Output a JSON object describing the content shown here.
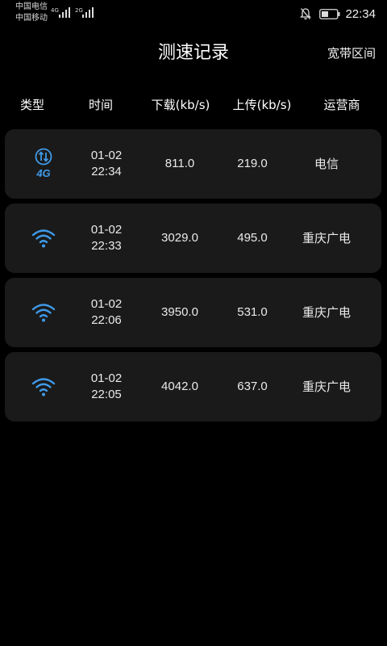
{
  "status_bar": {
    "carrier_1": "中国电信",
    "carrier_2": "中国移动",
    "net_1": "4G",
    "net_2": "2G",
    "time": "22:34"
  },
  "header": {
    "title": "测速记录",
    "bandwidth_label": "宽带区间"
  },
  "columns": [
    "类型",
    "时间",
    "下载(kb/s)",
    "上传(kb/s)",
    "运营商"
  ],
  "records": [
    {
      "type_icon": "4g-icon",
      "date": "01-02",
      "time": "22:34",
      "download": "811.0",
      "upload": "219.0",
      "carrier": "电信"
    },
    {
      "type_icon": "wifi-icon",
      "date": "01-02",
      "time": "22:33",
      "download": "3029.0",
      "upload": "495.0",
      "carrier": "重庆广电"
    },
    {
      "type_icon": "wifi-icon",
      "date": "01-02",
      "time": "22:06",
      "download": "3950.0",
      "upload": "531.0",
      "carrier": "重庆广电"
    },
    {
      "type_icon": "wifi-icon",
      "date": "01-02",
      "time": "22:05",
      "download": "4042.0",
      "upload": "637.0",
      "carrier": "重庆广电"
    }
  ],
  "colors": {
    "background": "#000000",
    "card": "#1a1a1a",
    "icon_blue": "#3f9ae8"
  }
}
